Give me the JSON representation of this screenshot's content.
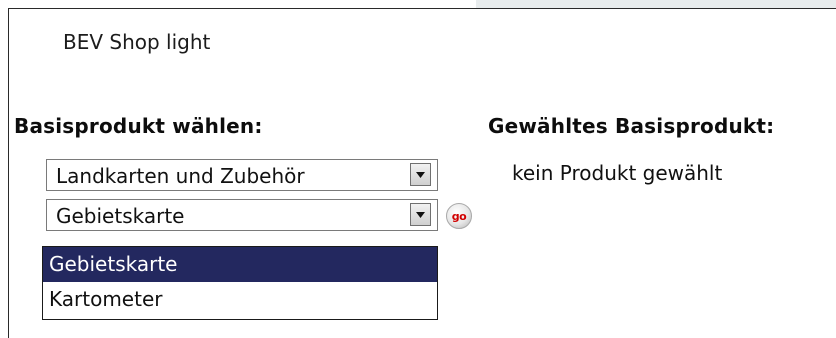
{
  "shop": {
    "title": "BEV Shop light"
  },
  "base_product": {
    "heading": "Basisprodukt wählen:",
    "category_select": {
      "value": "Landkarten und Zubehör"
    },
    "product_select": {
      "value": "Gebietskarte"
    },
    "go_button": {
      "label": "go"
    },
    "dropdown_options": [
      {
        "label": "Gebietskarte",
        "highlighted": true
      },
      {
        "label": "Kartometer",
        "highlighted": false
      }
    ]
  },
  "selected_product": {
    "heading": "Gewähltes Basisprodukt:",
    "value": "kein Produkt gewählt"
  },
  "colors": {
    "highlight": "#23285f",
    "go_text": "#d10000",
    "frame": "#2a2a2a"
  },
  "icons": {
    "select_arrow": "chevron-down-icon"
  }
}
